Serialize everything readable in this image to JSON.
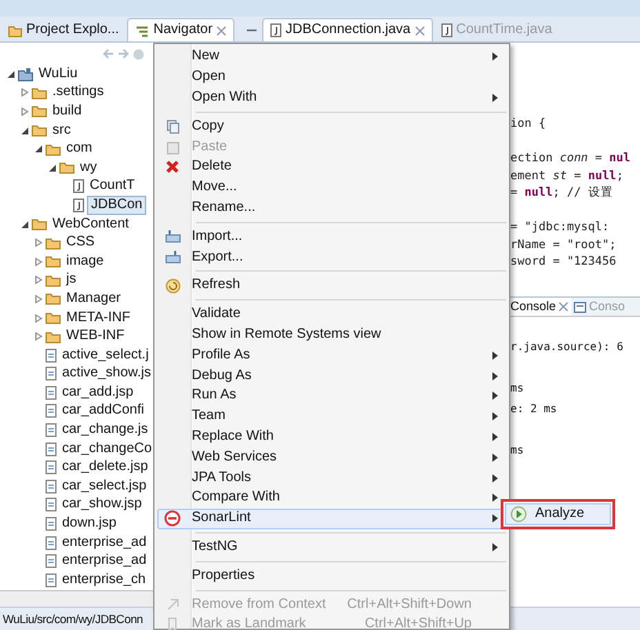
{
  "view_tabs": [
    {
      "label": "Project Explo...",
      "selected": false,
      "closable": false
    },
    {
      "label": "Navigator",
      "selected": true,
      "closable": true
    }
  ],
  "editor_tabs": [
    {
      "label": "JDBConnection.java",
      "selected": true,
      "closable": true
    },
    {
      "label": "CountTime.java",
      "selected": false,
      "closable": false
    }
  ],
  "tree": [
    {
      "label": "WuLiu",
      "kind": "project",
      "selected": false,
      "expanded": true,
      "children": [
        {
          "label": ".settings",
          "kind": "folder",
          "selected": false,
          "expanded": false
        },
        {
          "label": "build",
          "kind": "folder",
          "selected": false,
          "expanded": false
        },
        {
          "label": "src",
          "kind": "folder",
          "selected": false,
          "expanded": true,
          "children": [
            {
              "label": "com",
              "kind": "folder",
              "selected": false,
              "expanded": true,
              "children": [
                {
                  "label": "wy",
                  "kind": "folder",
                  "selected": false,
                  "expanded": true,
                  "children": [
                    {
                      "label": "CountT",
                      "kind": "java",
                      "selected": false
                    },
                    {
                      "label": "JDBCon",
                      "kind": "java",
                      "selected": true
                    }
                  ]
                }
              ]
            }
          ]
        },
        {
          "label": "WebContent",
          "kind": "folder",
          "selected": false,
          "expanded": true,
          "children": [
            {
              "label": "CSS",
              "kind": "folder",
              "selected": false,
              "expanded": false
            },
            {
              "label": "image",
              "kind": "folder",
              "selected": false,
              "expanded": false
            },
            {
              "label": "js",
              "kind": "folder",
              "selected": false,
              "expanded": false
            },
            {
              "label": "Manager",
              "kind": "folder",
              "selected": false,
              "expanded": false
            },
            {
              "label": "META-INF",
              "kind": "folder",
              "selected": false,
              "expanded": false
            },
            {
              "label": "WEB-INF",
              "kind": "folder",
              "selected": false,
              "expanded": false
            },
            {
              "label": "active_select.j",
              "kind": "jsp",
              "selected": false
            },
            {
              "label": "active_show.js",
              "kind": "jsp",
              "selected": false
            },
            {
              "label": "car_add.jsp",
              "kind": "jsp",
              "selected": false
            },
            {
              "label": "car_addConfi",
              "kind": "jsp",
              "selected": false
            },
            {
              "label": "car_change.js",
              "kind": "jsp",
              "selected": false
            },
            {
              "label": "car_changeCo",
              "kind": "jsp",
              "selected": false
            },
            {
              "label": "car_delete.jsp",
              "kind": "jsp",
              "selected": false
            },
            {
              "label": "car_select.jsp",
              "kind": "jsp",
              "selected": false
            },
            {
              "label": "car_show.jsp",
              "kind": "jsp",
              "selected": false
            },
            {
              "label": "down.jsp",
              "kind": "jsp",
              "selected": false
            },
            {
              "label": "enterprise_ad",
              "kind": "jsp",
              "selected": false
            },
            {
              "label": "enterprise_ad",
              "kind": "jsp",
              "selected": false
            },
            {
              "label": "enterprise_ch",
              "kind": "jsp",
              "selected": false
            }
          ]
        }
      ]
    }
  ],
  "editor": {
    "blocks": [
      [
        "ion {"
      ],
      [
        "ection *conn* = **nul**",
        "ement *st* = **null**;",
        "= **null**; // 设置"
      ],
      [
        "= \"jdbc:mysql:",
        "rName = \"root\";",
        "sword = \"123456"
      ]
    ]
  },
  "console": {
    "tabs": [
      {
        "label": "Console",
        "selected": true,
        "closable": true
      },
      {
        "label": "Conso",
        "selected": false,
        "closable": false
      }
    ],
    "blocks": [
      [
        "r.java.source): 6"
      ],
      [
        "ms",
        "e: 2 ms"
      ],
      [
        "ms"
      ]
    ]
  },
  "status_bar": "WuLiu/src/com/wy/JDBConn",
  "context_menu": {
    "items": [
      {
        "kind": "item",
        "label": "New",
        "submenu": true,
        "disabled": false,
        "selected": false
      },
      {
        "kind": "item",
        "label": "Open",
        "submenu": false,
        "disabled": false,
        "selected": false
      },
      {
        "kind": "item",
        "label": "Open With",
        "submenu": true,
        "disabled": false,
        "selected": false
      },
      {
        "kind": "separator"
      },
      {
        "kind": "item",
        "label": "Copy",
        "submenu": false,
        "disabled": false,
        "selected": false
      },
      {
        "kind": "item",
        "label": "Paste",
        "submenu": false,
        "disabled": true,
        "selected": false
      },
      {
        "kind": "item",
        "label": "Delete",
        "submenu": false,
        "disabled": false,
        "selected": false
      },
      {
        "kind": "item",
        "label": "Move...",
        "submenu": false,
        "disabled": false,
        "selected": false
      },
      {
        "kind": "item",
        "label": "Rename...",
        "submenu": false,
        "disabled": false,
        "selected": false
      },
      {
        "kind": "separator"
      },
      {
        "kind": "item",
        "label": "Import...",
        "submenu": false,
        "disabled": false,
        "selected": false
      },
      {
        "kind": "item",
        "label": "Export...",
        "submenu": false,
        "disabled": false,
        "selected": false
      },
      {
        "kind": "separator"
      },
      {
        "kind": "item",
        "label": "Refresh",
        "submenu": false,
        "disabled": false,
        "selected": false
      },
      {
        "kind": "separator"
      },
      {
        "kind": "item",
        "label": "Validate",
        "submenu": false,
        "disabled": false,
        "selected": false
      },
      {
        "kind": "item",
        "label": "Show in Remote Systems view",
        "submenu": false,
        "disabled": false,
        "selected": false
      },
      {
        "kind": "item",
        "label": "Profile As",
        "submenu": true,
        "disabled": false,
        "selected": false
      },
      {
        "kind": "item",
        "label": "Debug As",
        "submenu": true,
        "disabled": false,
        "selected": false
      },
      {
        "kind": "item",
        "label": "Run As",
        "submenu": true,
        "disabled": false,
        "selected": false
      },
      {
        "kind": "item",
        "label": "Team",
        "submenu": true,
        "disabled": false,
        "selected": false
      },
      {
        "kind": "item",
        "label": "Replace With",
        "submenu": true,
        "disabled": false,
        "selected": false
      },
      {
        "kind": "item",
        "label": "Web Services",
        "submenu": true,
        "disabled": false,
        "selected": false
      },
      {
        "kind": "item",
        "label": "JPA Tools",
        "submenu": true,
        "disabled": false,
        "selected": false
      },
      {
        "kind": "item",
        "label": "Compare With",
        "submenu": true,
        "disabled": false,
        "selected": false
      },
      {
        "kind": "item",
        "label": "SonarLint",
        "submenu": true,
        "disabled": false,
        "selected": true
      },
      {
        "kind": "separator"
      },
      {
        "kind": "item",
        "label": "TestNG",
        "submenu": true,
        "disabled": false,
        "selected": false
      },
      {
        "kind": "separator"
      },
      {
        "kind": "item",
        "label": "Properties",
        "submenu": false,
        "disabled": false,
        "selected": false
      },
      {
        "kind": "separator"
      },
      {
        "kind": "item",
        "label": "Remove from Context",
        "shortcut": "Ctrl+Alt+Shift+Down",
        "submenu": false,
        "disabled": true,
        "selected": false
      },
      {
        "kind": "item",
        "label": "Mark as Landmark",
        "shortcut": "Ctrl+Alt+Shift+Up",
        "submenu": false,
        "disabled": true,
        "selected": false
      }
    ]
  },
  "submenu": {
    "items": [
      {
        "label": "Analyze",
        "selected": true
      }
    ]
  }
}
